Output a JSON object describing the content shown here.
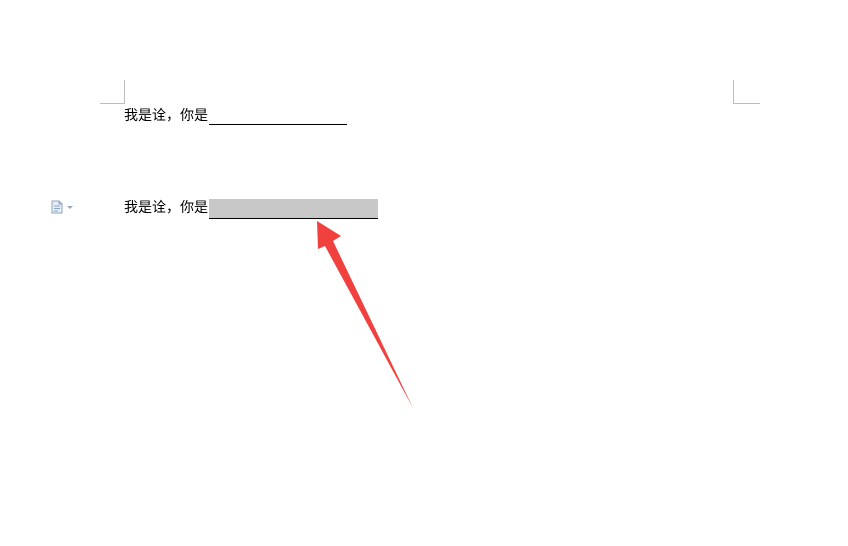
{
  "document": {
    "line1": {
      "text": "我是诠，你是"
    },
    "line2": {
      "text": "我是诠，你是"
    }
  },
  "paste_options": {
    "icon": "paste-options-icon",
    "dropdown_icon": "chevron-down-icon"
  },
  "annotation": {
    "arrow_color": "#f0413f"
  },
  "colors": {
    "highlight": "#c8c8c8",
    "text": "#000000",
    "margin_marks": "#bdbdbd"
  }
}
